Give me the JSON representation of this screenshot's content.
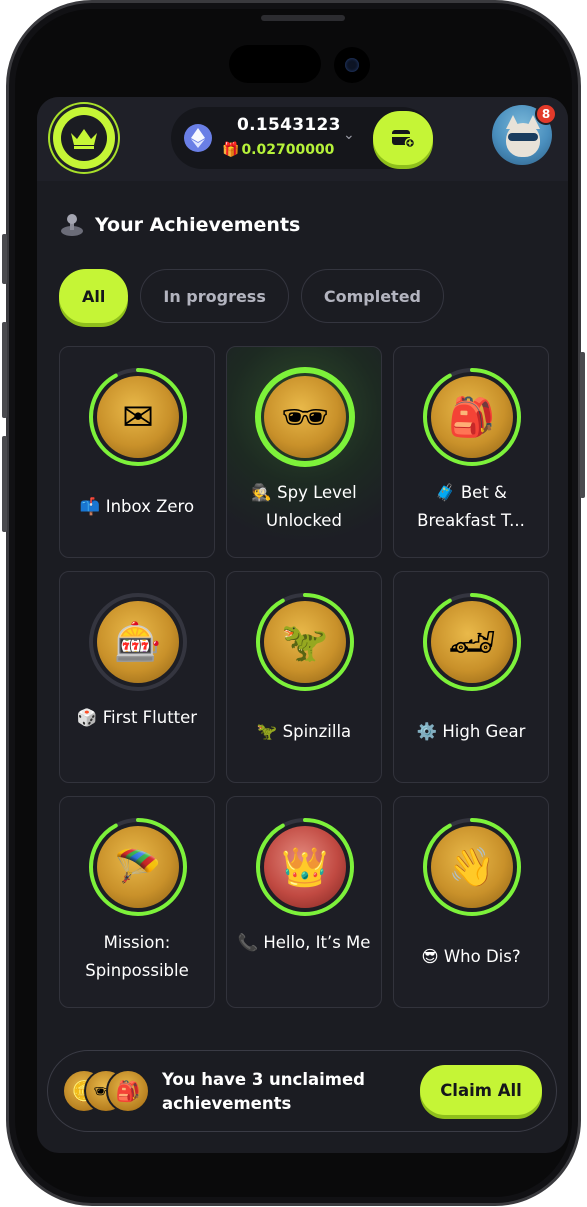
{
  "header": {
    "balance_main": "0.1543123",
    "balance_bonus": "0.02700000",
    "notification_count": "8"
  },
  "section": {
    "title": "Your Achievements"
  },
  "tabs": [
    {
      "label": "All",
      "active": true
    },
    {
      "label": "In progress",
      "active": false
    },
    {
      "label": "Completed",
      "active": false
    }
  ],
  "achievements": [
    {
      "emoji": "📫",
      "title": "Inbox Zero",
      "progress": 0.92,
      "medal_icon": "envelope-coin-icon"
    },
    {
      "emoji": "🕵️",
      "title": "Spy Level Unlocked",
      "progress": 1.0,
      "medal_icon": "spy-agent-icon"
    },
    {
      "emoji": "🧳",
      "title": "Bet & Breakfast T...",
      "progress": 0.92,
      "medal_icon": "traveler-coin-icon"
    },
    {
      "emoji": "🎲",
      "title": "First Flutter",
      "progress": 0.0,
      "medal_icon": "slot-coin-icon"
    },
    {
      "emoji": "🦖",
      "title": "Spinzilla",
      "progress": 0.92,
      "medal_icon": "dinosaur-coin-icon"
    },
    {
      "emoji": "⚙️",
      "title": "High Gear",
      "progress": 0.92,
      "medal_icon": "race-car-coin-icon"
    },
    {
      "emoji": "",
      "title": "Mission: Spinpossible",
      "progress": 0.92,
      "medal_icon": "parachute-coin-icon"
    },
    {
      "emoji": "📞",
      "title": "Hello, It’s Me",
      "progress": 0.92,
      "medal_icon": "crown-pillow-icon"
    },
    {
      "emoji": "😎",
      "title": "Who Dis?",
      "progress": 0.92,
      "medal_icon": "waving-coin-icon"
    }
  ],
  "bottom_bar": {
    "message": "You have 3 unclaimed achievements",
    "claim_label": "Claim All"
  },
  "colors": {
    "accent": "#c5f536",
    "ring_progress": "#7df23a",
    "background": "#1b1c22",
    "badge": "#e33a2a"
  }
}
